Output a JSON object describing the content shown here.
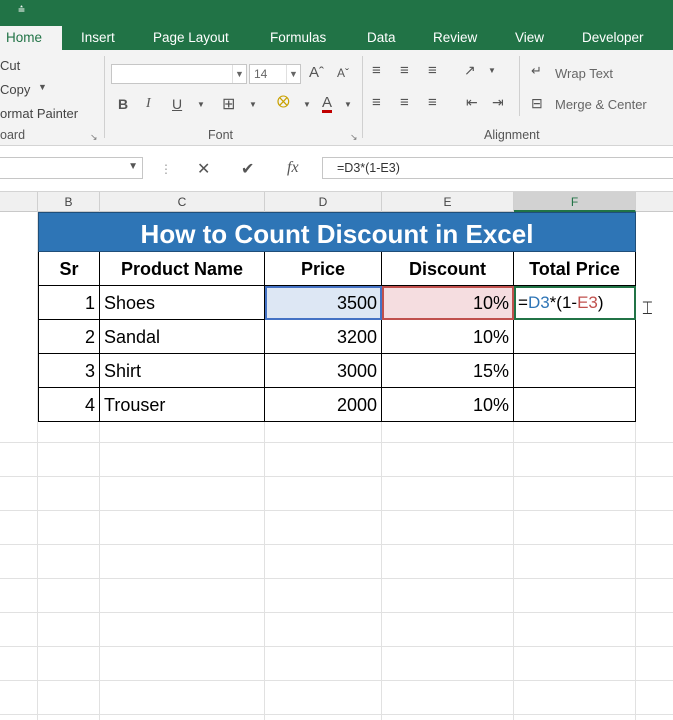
{
  "ribbon": {
    "tabs": [
      "Home",
      "Insert",
      "Page Layout",
      "Formulas",
      "Data",
      "Review",
      "View",
      "Developer"
    ],
    "clipboard": {
      "cut": "Cut",
      "copy": "Copy",
      "format_painter": "ormat Painter",
      "group_label": "oard"
    },
    "font": {
      "name": "",
      "size": "14",
      "group_label": "Font"
    },
    "alignment": {
      "wrap_text": "Wrap Text",
      "merge_center": "Merge & Center",
      "group_label": "Alignment"
    }
  },
  "formula_bar": {
    "name_box": "",
    "formula": "=D3*(1-E3)"
  },
  "columns": [
    "B",
    "C",
    "D",
    "E",
    "F"
  ],
  "sheet": {
    "title": "How to Count Discount in Excel",
    "headers": {
      "sr": "Sr",
      "product": "Product Name",
      "price": "Price",
      "discount": "Discount",
      "total": "Total Price"
    },
    "rows": [
      {
        "sr": "1",
        "product": "Shoes",
        "price": "3500",
        "discount": "10%",
        "total": ""
      },
      {
        "sr": "2",
        "product": "Sandal",
        "price": "3200",
        "discount": "10%",
        "total": ""
      },
      {
        "sr": "3",
        "product": "Shirt",
        "price": "3000",
        "discount": "15%",
        "total": ""
      },
      {
        "sr": "4",
        "product": "Trouser",
        "price": "2000",
        "discount": "10%",
        "total": ""
      }
    ],
    "edit_formula": {
      "eq": "=",
      "ref1": "D3",
      "mid": "*(1-",
      "ref2": "E3",
      "end": ")"
    }
  },
  "colors": {
    "excel_green": "#217346",
    "banner_blue": "#2e75b6",
    "ref_blue": "#4472c4",
    "ref_red": "#c0504d"
  }
}
